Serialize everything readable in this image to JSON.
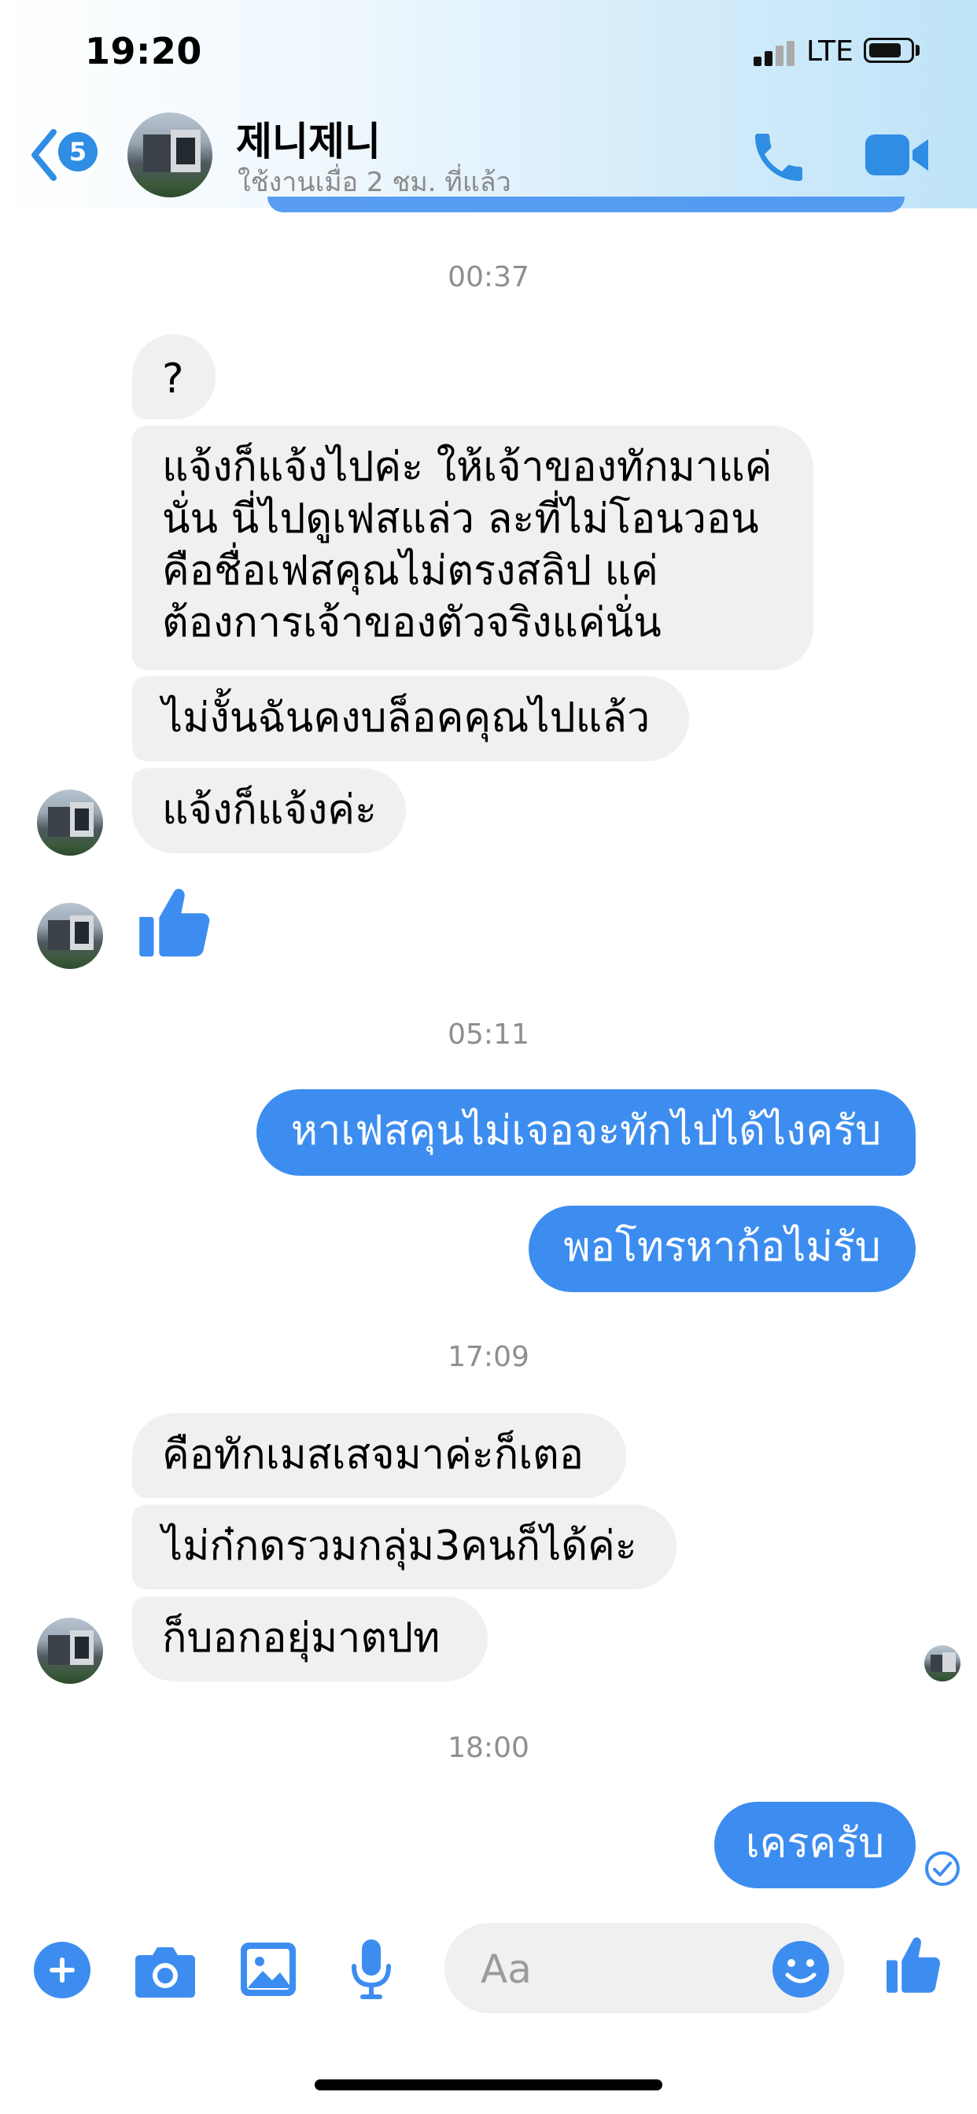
{
  "status_bar": {
    "time": "19:20",
    "network": "LTE"
  },
  "header": {
    "back_badge": "5",
    "contact_name": "제니제니",
    "contact_status": "ใช้งานเมื่อ 2 ชม. ที่แล้ว"
  },
  "timestamps": {
    "t1": "00:37",
    "t2": "05:11",
    "t3": "17:09",
    "t4": "18:00"
  },
  "messages": [
    {
      "text": "?"
    },
    {
      "lines": [
        "แจ้งก็แจ้งไปค่ะ ให้เจ้าของทักมาแค่",
        "นั่น นี่ไปดูเฟสแล่ว ละที่ไม่โอนวอน",
        "คือชื่อเฟสคุณไม่ตรงสลิป แค่",
        "ต้องการเจ้าของตัวจริงแค่นั่น"
      ]
    },
    {
      "text": "ไม่งั้นฉันคงบล็อคคุณไปแล้ว"
    },
    {
      "text": "แจ้งก็แจ้งค่ะ"
    },
    {
      "text": "หาเฟสคุนไม่เจอจะทักไปได้ไงครับ"
    },
    {
      "text": "พอโทรหาก้อไม่รับ"
    },
    {
      "text": "คือทักเมสเสจมาค่ะก็เตอ"
    },
    {
      "text": "ไม่ก๋กดรวมกลุ่ม3คนก็ได้ค่ะ"
    },
    {
      "text": "ก็บอกอยุ่มาตปท"
    },
    {
      "text": "เครครับ"
    }
  ],
  "composer": {
    "placeholder": "Aa"
  },
  "colors": {
    "accent": "#3d8df0",
    "incoming_bubble": "#f0f0f0",
    "timestamp": "#8e8e93"
  },
  "icons": {
    "back": "chevron-left-icon",
    "call": "phone-icon",
    "video": "video-camera-icon",
    "like": "thumbs-up-icon",
    "add": "plus-circle-icon",
    "camera": "camera-icon",
    "gallery": "image-icon",
    "voice": "microphone-icon",
    "emoji": "smiley-icon",
    "seen": "check-circle-icon"
  }
}
